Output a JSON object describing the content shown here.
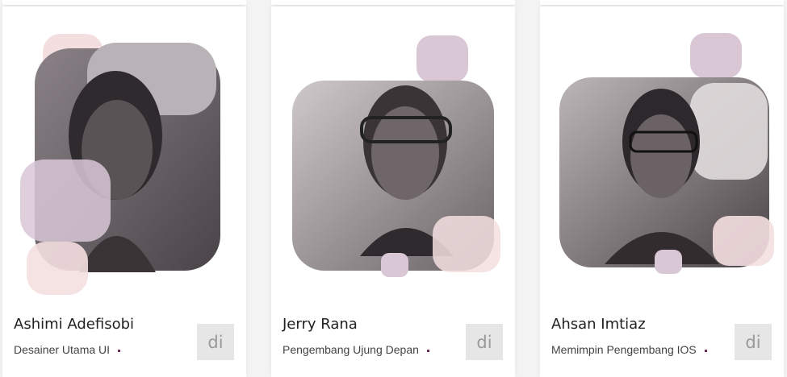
{
  "cards": [
    {
      "name": "Ashimi Adefisobi",
      "role": "Desainer Utama UI",
      "social_label": "di",
      "photo_icon": "portrait-photo"
    },
    {
      "name": "Jerry Rana",
      "role": "Pengembang Ujung Depan",
      "social_label": "di",
      "photo_icon": "portrait-photo"
    },
    {
      "name": "Ahsan Imtiaz",
      "role": "Memimpin Pengembang IOS",
      "social_label": "di",
      "photo_icon": "portrait-photo"
    }
  ],
  "colors": {
    "accent": "#6b2d5c",
    "blob_pink": "#f4dfe0",
    "blob_mauve": "#d9c7d6"
  }
}
